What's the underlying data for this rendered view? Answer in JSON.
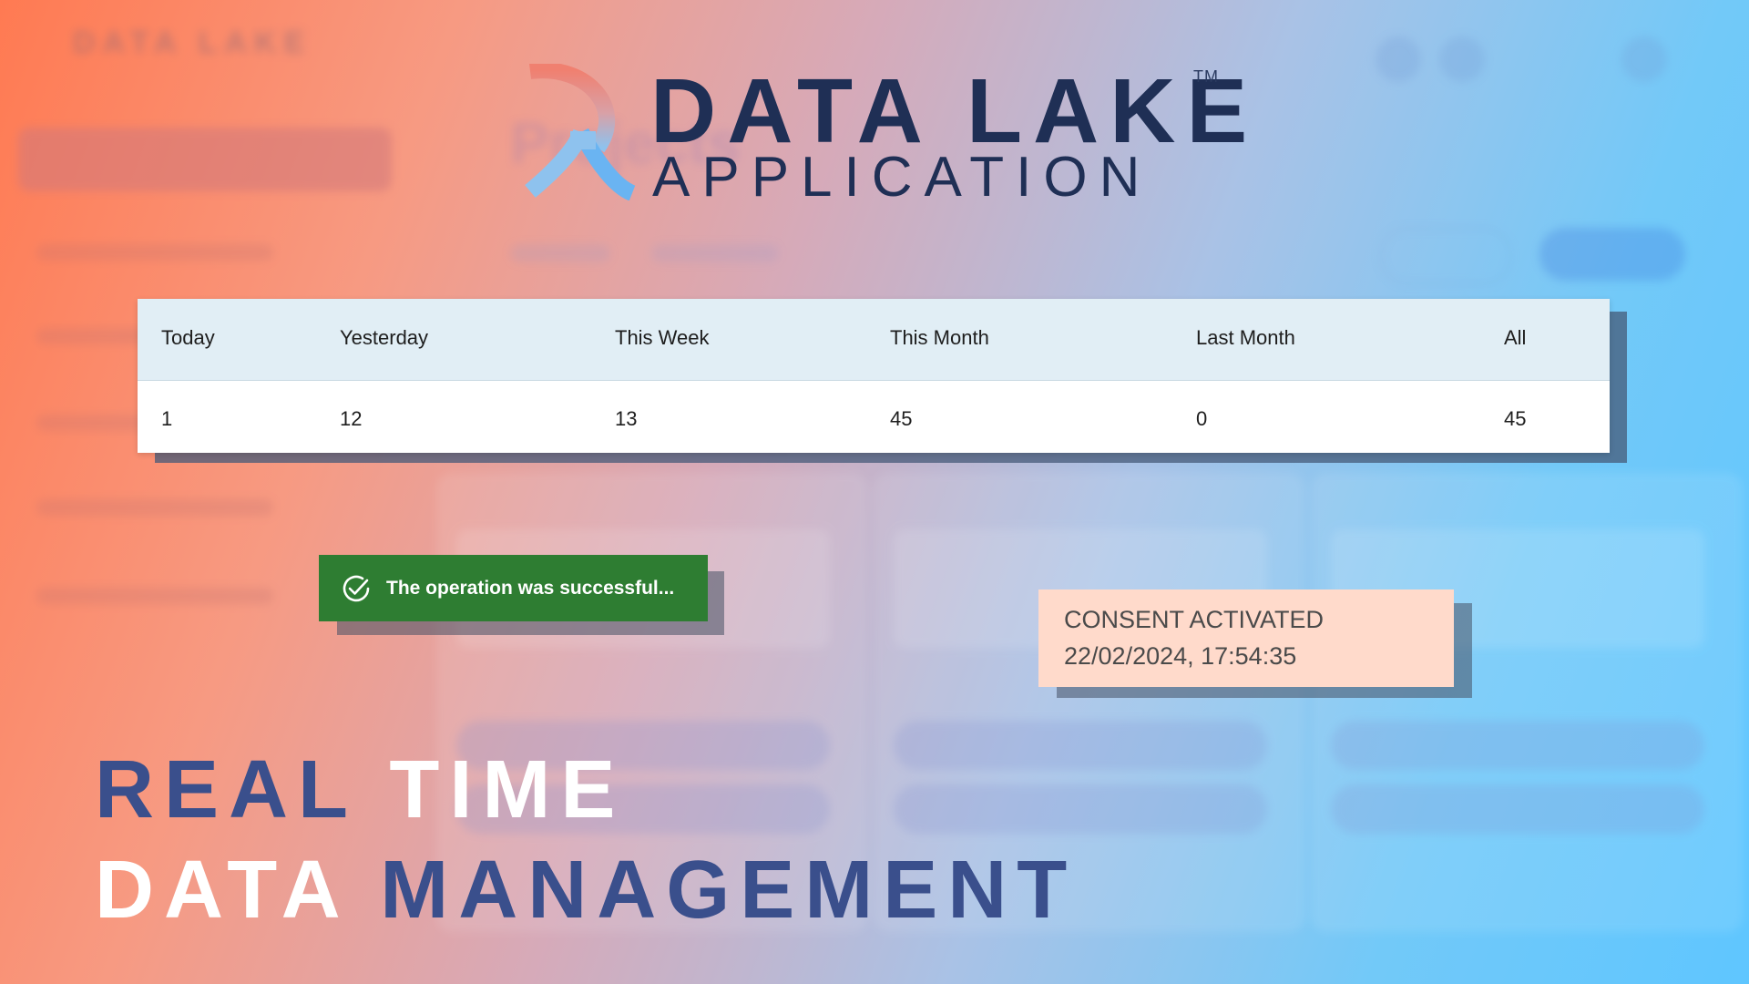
{
  "logo": {
    "title": "DATA LAKE",
    "trademark": "TM",
    "subtitle": "APPLICATION"
  },
  "stats": {
    "headers": [
      "Today",
      "Yesterday",
      "This Week",
      "This Month",
      "Last Month",
      "All"
    ],
    "values": [
      "1",
      "12",
      "13",
      "45",
      "0",
      "45"
    ]
  },
  "toast": {
    "message": "The operation was successful...",
    "icon": "check-circle-icon",
    "color": "#2e7d32"
  },
  "consent": {
    "title": "CONSENT ACTIVATED",
    "timestamp": "22/02/2024, 17:54:35"
  },
  "headline": {
    "line1_part1": "REAL",
    "line1_part2": "TIME",
    "line2_part1": "DATA",
    "line2_part2": "MANAGEMENT"
  },
  "colors": {
    "brand_navy": "#1f2f55",
    "headline_blue": "#3a4f8c",
    "consent_bg": "#ffdacb",
    "table_header_bg": "#e1eef5"
  }
}
